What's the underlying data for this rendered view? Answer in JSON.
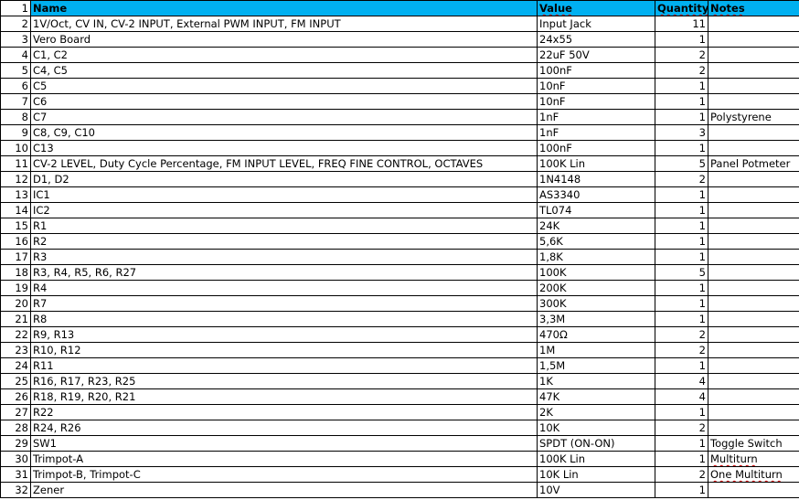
{
  "header": {
    "row_number": "1",
    "name": "Name",
    "value": "Value",
    "quantity": "Quantity",
    "notes": "Notes"
  },
  "rows": [
    {
      "n": "2",
      "name": "1V/Oct, CV IN, CV-2 INPUT, External PWM INPUT, FM INPUT",
      "value": "Input Jack",
      "qty": "11",
      "notes": ""
    },
    {
      "n": "3",
      "name": "Vero Board",
      "value": "24x55",
      "qty": "1",
      "notes": ""
    },
    {
      "n": "4",
      "name": "C1, C2",
      "value": "22uF 50V",
      "qty": "2",
      "notes": ""
    },
    {
      "n": "5",
      "name": "C4, C5",
      "value": "100nF",
      "qty": "2",
      "notes": ""
    },
    {
      "n": "6",
      "name": "C5",
      "value": "10nF",
      "qty": "1",
      "notes": ""
    },
    {
      "n": "7",
      "name": "C6",
      "value": "10nF",
      "qty": "1",
      "notes": ""
    },
    {
      "n": "8",
      "name": "C7",
      "value": "1nF",
      "qty": "1",
      "notes": "Polystyrene"
    },
    {
      "n": "9",
      "name": "C8, C9, C10",
      "value": "1nF",
      "qty": "3",
      "notes": ""
    },
    {
      "n": "10",
      "name": "C13",
      "value": "100nF",
      "qty": "1",
      "notes": ""
    },
    {
      "n": "11",
      "name": "CV-2 LEVEL, Duty Cycle Percentage, FM INPUT LEVEL, FREQ FINE CONTROL, OCTAVES",
      "value": "100K Lin",
      "qty": "5",
      "notes": "Panel Potmeter"
    },
    {
      "n": "12",
      "name": "D1, D2",
      "value": "1N4148",
      "qty": "2",
      "notes": ""
    },
    {
      "n": "13",
      "name": "IC1",
      "value": "AS3340",
      "qty": "1",
      "notes": ""
    },
    {
      "n": "14",
      "name": "IC2",
      "value": "TL074",
      "qty": "1",
      "notes": ""
    },
    {
      "n": "15",
      "name": "R1",
      "value": "24K",
      "qty": "1",
      "notes": ""
    },
    {
      "n": "16",
      "name": "R2",
      "value": "5,6K",
      "qty": "1",
      "notes": ""
    },
    {
      "n": "17",
      "name": "R3",
      "value": "1,8K",
      "qty": "1",
      "notes": ""
    },
    {
      "n": "18",
      "name": "R3, R4, R5, R6, R27",
      "value": "100K",
      "qty": "5",
      "notes": ""
    },
    {
      "n": "19",
      "name": "R4",
      "value": "200K",
      "qty": "1",
      "notes": ""
    },
    {
      "n": "20",
      "name": "R7",
      "value": "300K",
      "qty": "1",
      "notes": ""
    },
    {
      "n": "21",
      "name": "R8",
      "value": "3,3M",
      "qty": "1",
      "notes": ""
    },
    {
      "n": "22",
      "name": "R9, R13",
      "value": "470Ω",
      "qty": "2",
      "notes": ""
    },
    {
      "n": "23",
      "name": "R10, R12",
      "value": "1M",
      "qty": "2",
      "notes": ""
    },
    {
      "n": "24",
      "name": "R11",
      "value": "1,5M",
      "qty": "1",
      "notes": ""
    },
    {
      "n": "25",
      "name": "R16, R17, R23, R25",
      "value": "1K",
      "qty": "4",
      "notes": ""
    },
    {
      "n": "26",
      "name": "R18, R19, R20, R21",
      "value": "47K",
      "qty": "4",
      "notes": ""
    },
    {
      "n": "27",
      "name": "R22",
      "value": "2K",
      "qty": "1",
      "notes": ""
    },
    {
      "n": "28",
      "name": "R24, R26",
      "value": "10K",
      "qty": "2",
      "notes": ""
    },
    {
      "n": "29",
      "name": "SW1",
      "value": "SPDT  (ON-ON)",
      "qty": "1",
      "notes": "Toggle Switch"
    },
    {
      "n": "30",
      "name": "Trimpot-A",
      "value": "100K Lin",
      "qty": "1",
      "notes": "Multiturn"
    },
    {
      "n": "31",
      "name": "Trimpot-B, Trimpot-C",
      "value": "10K Lin",
      "qty": "2",
      "notes": "One Multiturn"
    },
    {
      "n": "32",
      "name": "Zener",
      "value": "10V",
      "qty": "1",
      "notes": ""
    }
  ],
  "colors": {
    "header_fill": "#00b0f0",
    "spellcheck_underline": "#d00000"
  }
}
